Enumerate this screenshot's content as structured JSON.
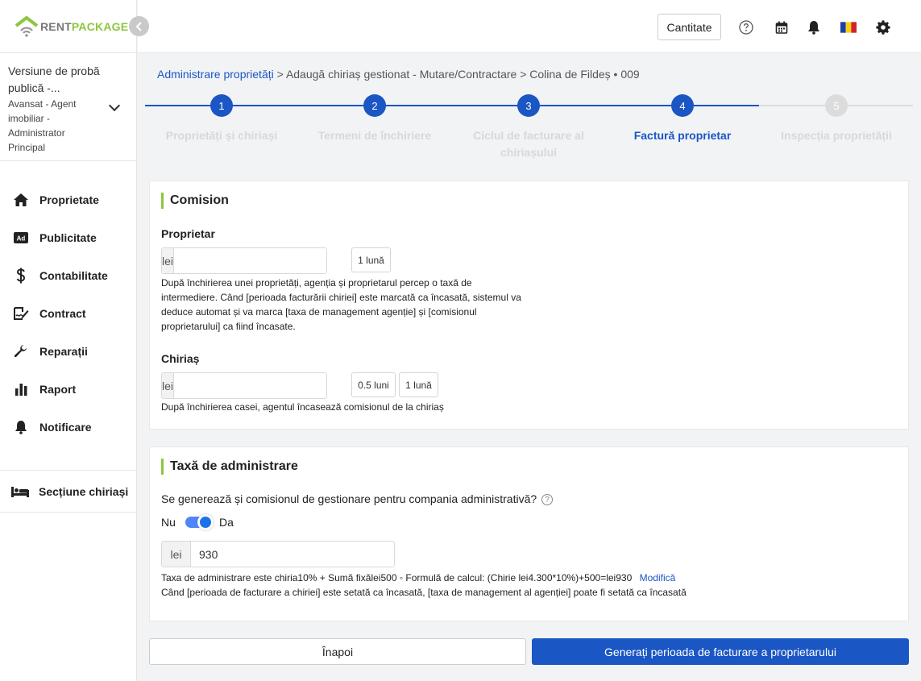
{
  "brand": {
    "name_part1": "RENT",
    "name_part2": "PACKAGE",
    "green": "#8cc63f",
    "blue": "#1a56c4"
  },
  "account": {
    "title": "Versiune de probă publică -...",
    "role": "Avansat - Agent imobiliar - Administrator Principal"
  },
  "nav": {
    "items": [
      {
        "label": "Proprietate",
        "icon": "home-icon"
      },
      {
        "label": "Publicitate",
        "icon": "ad-icon"
      },
      {
        "label": "Contabilitate",
        "icon": "dollar-icon"
      },
      {
        "label": "Contract",
        "icon": "contract-icon"
      },
      {
        "label": "Reparații",
        "icon": "wrench-icon"
      },
      {
        "label": "Raport",
        "icon": "bar-chart-icon"
      },
      {
        "label": "Notificare",
        "icon": "bell-icon"
      }
    ],
    "tenant_section": "Secțiune chiriași"
  },
  "topbar": {
    "quantity_button": "Cantitate"
  },
  "breadcrumb": {
    "root": "Administrare proprietăți",
    "sep": ">",
    "path": "Adaugă chiriaș gestionat - Mutare/Contractare",
    "sep2": ">",
    "property": "Colina de Fildeș • 009"
  },
  "stepper": {
    "current_step": 4,
    "steps": [
      {
        "number": "1",
        "label": "Proprietăți și chiriași"
      },
      {
        "number": "2",
        "label": "Termeni de închiriere"
      },
      {
        "number": "3",
        "label": "Ciclul de facturare al chiriașului"
      },
      {
        "number": "4",
        "label": "Factură proprietar"
      },
      {
        "number": "5",
        "label": "Inspecția proprietății"
      }
    ]
  },
  "commission": {
    "title": "Comision",
    "owner_label": "Proprietar",
    "owner_prefix": "lei",
    "owner_value": "",
    "owner_chip": "1 lună",
    "owner_help": "După închirierea unei proprietăți, agenția și proprietarul percep o taxă de intermediere. Când [perioada facturării chiriei] este marcată ca încasată, sistemul va deduce automat și va marca [taxa de management agenție] și [comisionul proprietarului] ca fiind încasate.",
    "tenant_label": "Chiriaș",
    "tenant_prefix": "lei",
    "tenant_value": "",
    "tenant_chip_1": "0.5 luni",
    "tenant_chip_2": "1 lună",
    "tenant_help": "După închirierea casei, agentul încasează comisionul de la chiriaș"
  },
  "admin_fee": {
    "title": "Taxă de administrare",
    "question": "Se generează și comisionul de gestionare pentru compania administrativă?",
    "toggle_off": "Nu",
    "toggle_on": "Da",
    "toggle_state": "Da",
    "prefix": "lei",
    "value": "930",
    "formula": "Taxa de administrare este chiria10% + Sumă fixălei500 ◦ Formulă de calcul: (Chirie lei4.300*10%)+500=lei930",
    "modify": "Modifică",
    "note": "Când [perioada de facturare a chiriei] este setată ca încasată, [taxa de management al agenției] poate fi setată ca încasată"
  },
  "footer": {
    "back": "Înapoi",
    "generate": "Generați perioada de facturare a proprietarului"
  }
}
